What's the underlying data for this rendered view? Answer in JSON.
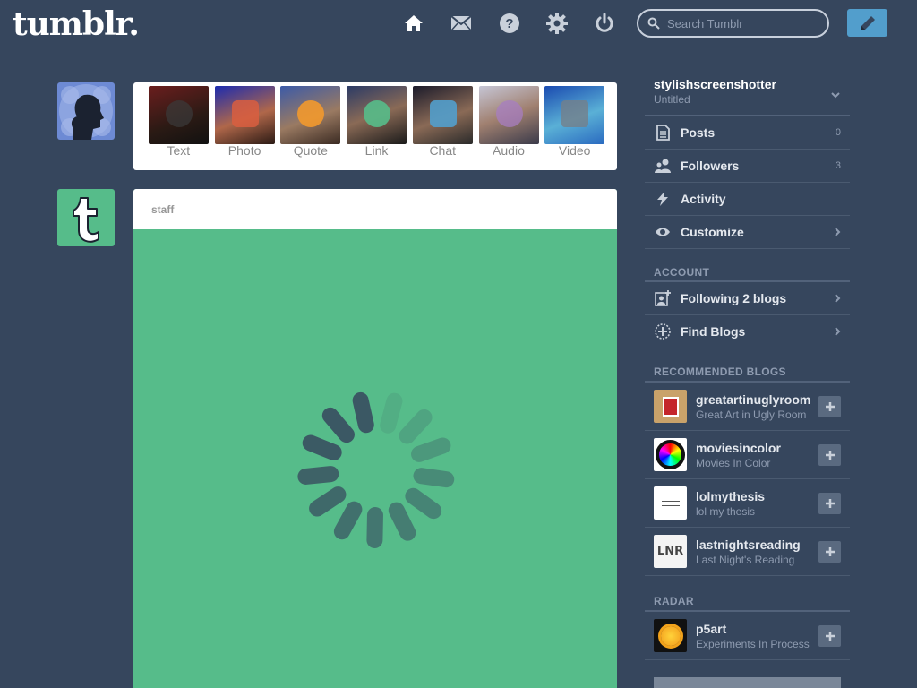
{
  "header": {
    "logo": "tumblr.",
    "search_placeholder": "Search Tumblr",
    "icons": [
      "home-icon",
      "mail-icon",
      "help-icon",
      "settings-icon",
      "power-icon",
      "pencil-icon"
    ]
  },
  "post_types": [
    {
      "label": "Text",
      "icon": "text-icon",
      "tint": "#3b3b3b"
    },
    {
      "label": "Photo",
      "icon": "camera-icon",
      "tint": "#d95e40"
    },
    {
      "label": "Quote",
      "icon": "quote-icon",
      "tint": "#f2992e"
    },
    {
      "label": "Link",
      "icon": "link-icon",
      "tint": "#56bc8a"
    },
    {
      "label": "Chat",
      "icon": "chat-icon",
      "tint": "#529ecc"
    },
    {
      "label": "Audio",
      "icon": "headphones-icon",
      "tint": "#a77dc2"
    },
    {
      "label": "Video",
      "icon": "video-icon",
      "tint": "#748089"
    }
  ],
  "post": {
    "author": "staff"
  },
  "sidebar": {
    "blog_name": "stylishscreenshotter",
    "blog_title": "Untitled",
    "items": [
      {
        "label": "Posts",
        "count": "0",
        "icon": "posts-icon"
      },
      {
        "label": "Followers",
        "count": "3",
        "icon": "followers-icon"
      },
      {
        "label": "Activity",
        "count": "",
        "icon": "activity-icon"
      },
      {
        "label": "Customize",
        "count": "",
        "icon": "eye-icon"
      }
    ],
    "account_title": "ACCOUNT",
    "account_items": [
      {
        "label": "Following 2 blogs",
        "icon": "following-icon"
      },
      {
        "label": "Find Blogs",
        "icon": "compass-icon"
      }
    ],
    "recommended_title": "RECOMMENDED BLOGS",
    "recommended": [
      {
        "name": "greatartinuglyroom",
        "desc": "Great Art in Ugly Room"
      },
      {
        "name": "moviesincolor",
        "desc": "Movies In Color"
      },
      {
        "name": "lolmythesis",
        "desc": "lol my thesis"
      },
      {
        "name": "lastnightsreading",
        "desc": "Last Night's Reading"
      }
    ],
    "radar_title": "RADAR",
    "radar": [
      {
        "name": "p5art",
        "desc": "Experiments In Process"
      }
    ]
  }
}
